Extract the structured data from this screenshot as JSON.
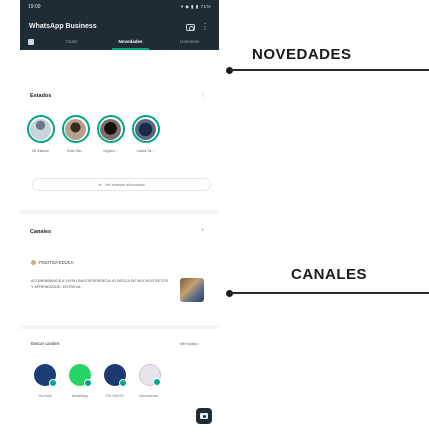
{
  "statusbar": {
    "time": "19:09",
    "system": "▾ ◆ ▮ ▮ 71%"
  },
  "appbar": {
    "title": "WhatsApp Business",
    "tabs": [
      "Chats",
      "Novedades",
      "Llamadas"
    ],
    "active_tab": "Novedades"
  },
  "status_section": {
    "title": "Estados",
    "more": "⋮",
    "items": [
      {
        "name": "Mi estado"
      },
      {
        "name": "Kids Ma..."
      },
      {
        "name": "Organi..."
      },
      {
        "name": "Laura Ta..."
      }
    ],
    "mute_button": "Ver estados silenciados"
  },
  "channels_section": {
    "title": "Canales",
    "add": "+",
    "channel_name": "POSITIVA EDUCA",
    "channel_message": "ACOMPAÑAMOS A VIVIR UNA EXPERIENCIA 40 DESCA DE MUCHOS RETOS Y APRENDIZAJE: ENTREVA...",
    "find_title": "Buscar canales",
    "find_all": "Ver todos ›",
    "suggested": [
      {
        "name": "YouTube"
      },
      {
        "name": "WhatsApp"
      },
      {
        "name": "FM RADIO"
      },
      {
        "name": "Movimiento..."
      }
    ]
  },
  "annotations": {
    "top": "NOVEDADES",
    "bottom": "CANALES"
  }
}
